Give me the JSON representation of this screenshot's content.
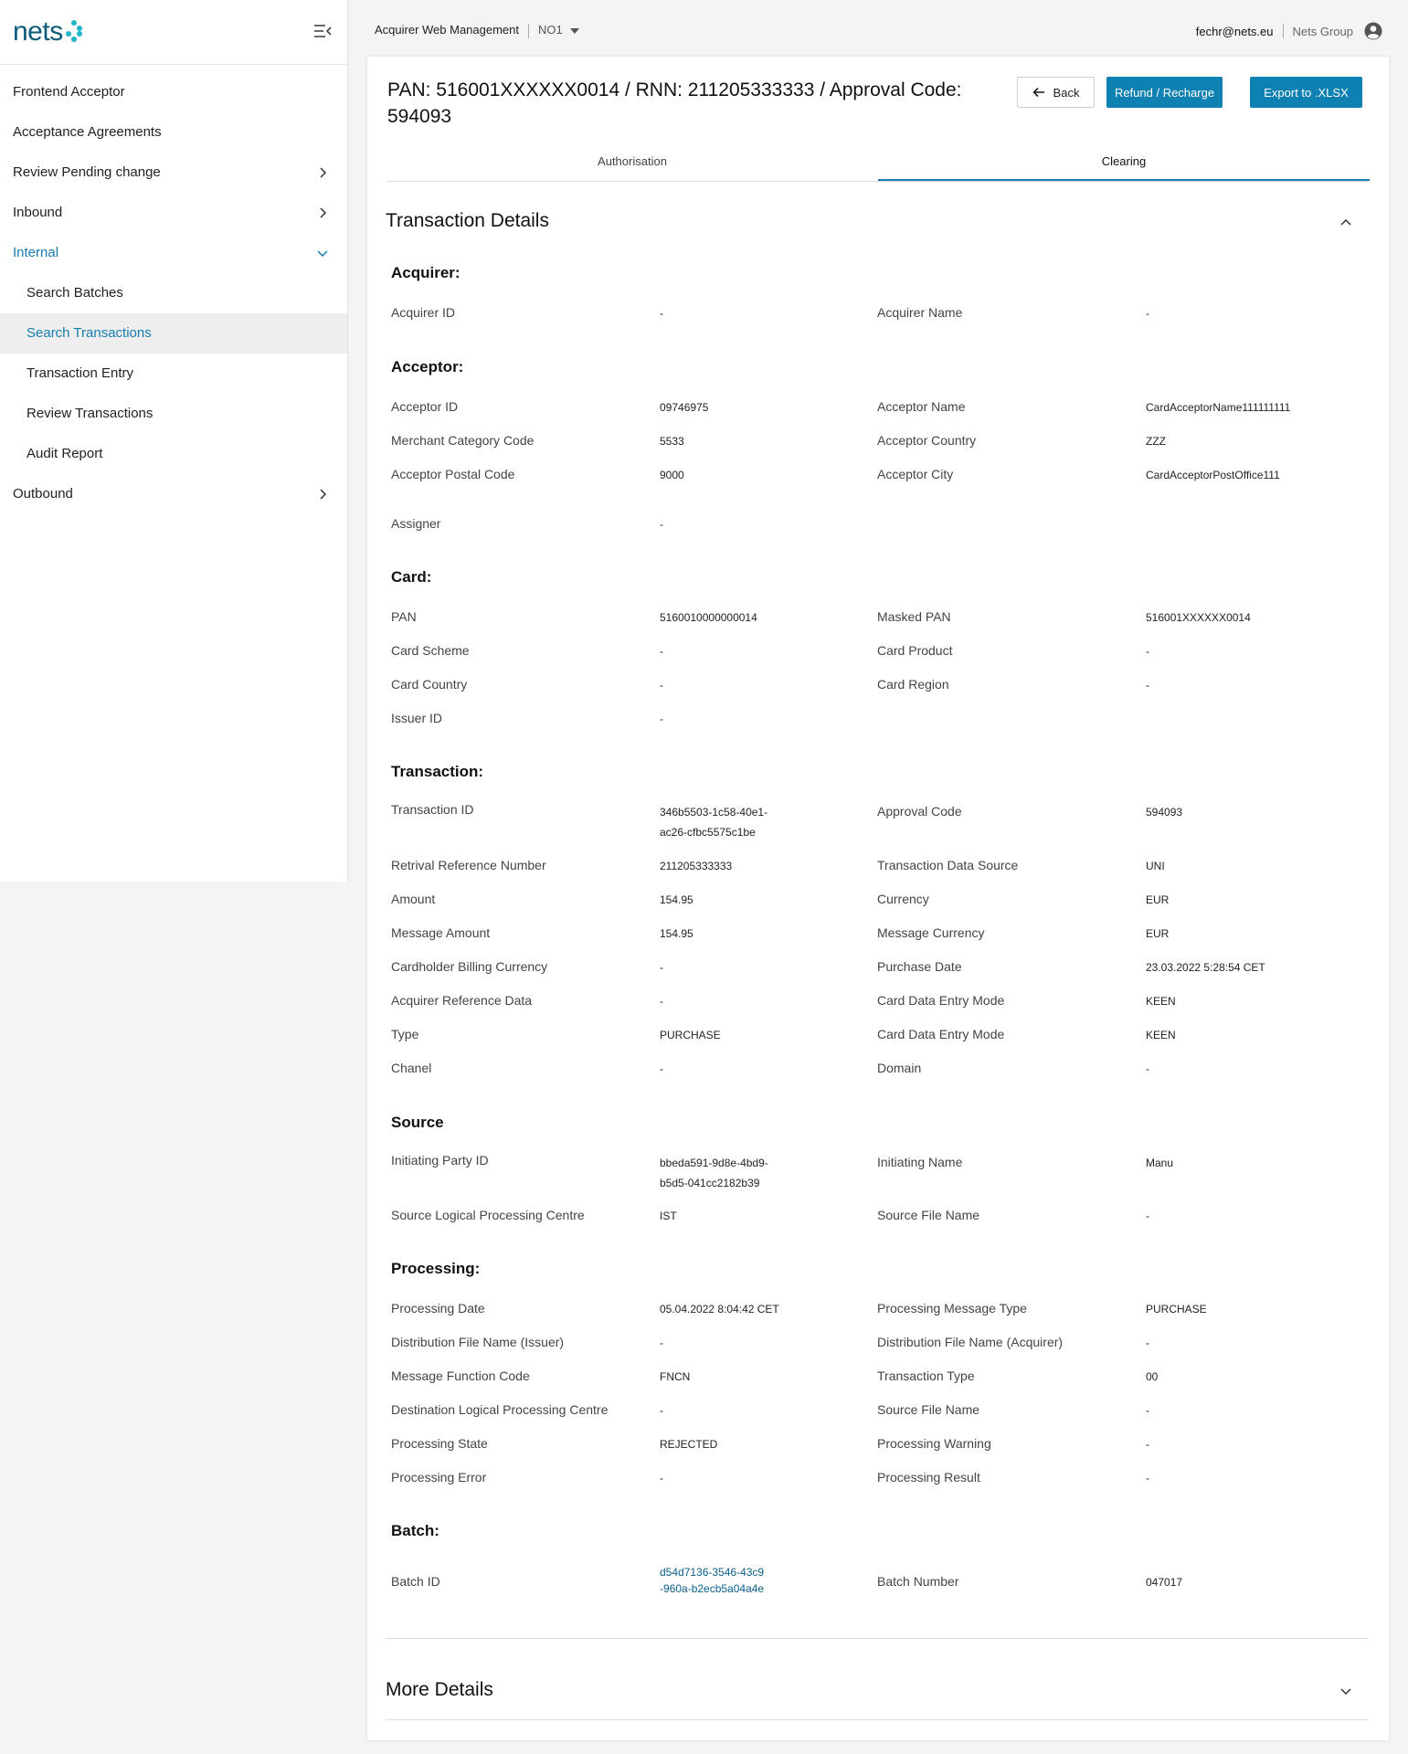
{
  "sidebar": {
    "brand": "nets",
    "items": [
      {
        "label": "Frontend Acceptor"
      },
      {
        "label": "Acceptance Agreements"
      },
      {
        "label": "Review Pending change"
      },
      {
        "label": "Inbound"
      },
      {
        "label": "Internal"
      },
      {
        "label": "Search Batches"
      },
      {
        "label": "Search Transactions"
      },
      {
        "label": "Transaction Entry"
      },
      {
        "label": "Review Transactions"
      },
      {
        "label": "Audit Report"
      },
      {
        "label": "Outbound"
      }
    ]
  },
  "header": {
    "app_title": "Acquirer Web Management",
    "environment": "NO1",
    "user_email": "fechr@nets.eu",
    "org": "Nets Group"
  },
  "page": {
    "title": "PAN: 516001XXXXXX0014 / RNN: 211205333333 / Approval Code: 594093",
    "back_label": "Back",
    "refund_label": "Refund / Recharge",
    "export_label": "Export to .XLSX"
  },
  "tabs": [
    {
      "label": "Authorisation"
    },
    {
      "label": "Clearing"
    }
  ],
  "details": {
    "title": "Transaction Details",
    "groups": {
      "acquirer": {
        "title": "Acquirer:",
        "fields": [
          {
            "label": "Acquirer ID",
            "value": "-"
          },
          {
            "label": "Acquirer Name",
            "value": "-"
          }
        ]
      },
      "acceptor": {
        "title": "Acceptor:",
        "fields": [
          {
            "label": "Acceptor ID",
            "value": "09746975"
          },
          {
            "label": "Acceptor Name",
            "value": "CardAcceptorName111111111"
          },
          {
            "label": "Merchant Category Code",
            "value": "5533"
          },
          {
            "label": "Acceptor Country",
            "value": "ZZZ"
          },
          {
            "label": "Acceptor Postal Code",
            "value": "9000"
          },
          {
            "label": "Acceptor City",
            "value": "CardAcceptorPostOffice111"
          },
          {
            "label": "Assigner",
            "value": "-"
          }
        ]
      },
      "card": {
        "title": "Card:",
        "fields": [
          {
            "label": "PAN",
            "value": "5160010000000014"
          },
          {
            "label": "Masked PAN",
            "value": "516001XXXXXX0014"
          },
          {
            "label": "Card Scheme",
            "value": "-"
          },
          {
            "label": "Card Product",
            "value": "-"
          },
          {
            "label": "Card Country",
            "value": "-"
          },
          {
            "label": "Card Region",
            "value": "-"
          },
          {
            "label": "Issuer ID",
            "value": "-"
          }
        ]
      },
      "transaction": {
        "title": "Transaction:",
        "fields": [
          {
            "label": "Transaction ID",
            "value1": "346b5503-1c58-40e1-",
            "value2": "ac26-cfbc5575c1be"
          },
          {
            "label": "Approval Code",
            "value": "594093"
          },
          {
            "label": "Retrival Reference Number",
            "value": "211205333333"
          },
          {
            "label": "Transaction Data Source",
            "value": "UNI"
          },
          {
            "label": "Amount",
            "value": "154.95"
          },
          {
            "label": "Currency",
            "value": "EUR"
          },
          {
            "label": "Message Amount",
            "value": "154.95"
          },
          {
            "label": "Message Currency",
            "value": "EUR"
          },
          {
            "label": "Cardholder Billing Currency",
            "value": "-"
          },
          {
            "label": "Purchase Date",
            "value": "23.03.2022 5:28:54 CET"
          },
          {
            "label": "Acquirer Reference Data",
            "value": "-"
          },
          {
            "label": "Card Data Entry Mode",
            "value": "KEEN"
          },
          {
            "label": "Type",
            "value": "PURCHASE"
          },
          {
            "label": "Card Data Entry Mode",
            "value": "KEEN"
          },
          {
            "label": "Chanel",
            "value": "-"
          },
          {
            "label": "Domain",
            "value": "-"
          }
        ]
      },
      "source": {
        "title": "Source",
        "fields": [
          {
            "label": "Initiating Party ID",
            "value1": "bbeda591-9d8e-4bd9-",
            "value2": "b5d5-041cc2182b39"
          },
          {
            "label": "Initiating Name",
            "value": "Manu"
          },
          {
            "label": "Source Logical Processing Centre",
            "value": "IST"
          },
          {
            "label": "Source File Name",
            "value": "-"
          }
        ]
      },
      "processing": {
        "title": "Processing:",
        "fields": [
          {
            "label": "Processing Date",
            "value": "05.04.2022 8:04:42 CET"
          },
          {
            "label": "Processing Message Type",
            "value": "PURCHASE"
          },
          {
            "label": "Distribution File Name (Issuer)",
            "value": "-"
          },
          {
            "label": "Distribution File Name (Acquirer)",
            "value": "-"
          },
          {
            "label": "Message Function Code",
            "value": "FNCN"
          },
          {
            "label": "Transaction Type",
            "value": "00"
          },
          {
            "label": "Destination Logical Processing Centre",
            "value": "-"
          },
          {
            "label": "Source File Name",
            "value": "-"
          },
          {
            "label": "Processing State",
            "value": "REJECTED"
          },
          {
            "label": "Processing Warning",
            "value": "-"
          },
          {
            "label": "Processing Error",
            "value": "-"
          },
          {
            "label": "Processing Result",
            "value": "-"
          }
        ]
      },
      "batch": {
        "title": "Batch:",
        "fields": [
          {
            "label": "Batch ID",
            "value1": "d54d7136-3546-43c9",
            "value2": "-960a-b2ecb5a04a4e"
          },
          {
            "label": "Batch Number",
            "value": "047017"
          }
        ]
      }
    }
  },
  "more_details": {
    "title": "More Details"
  },
  "colors": {
    "accent": "#0e80b1",
    "link": "#157db0"
  }
}
